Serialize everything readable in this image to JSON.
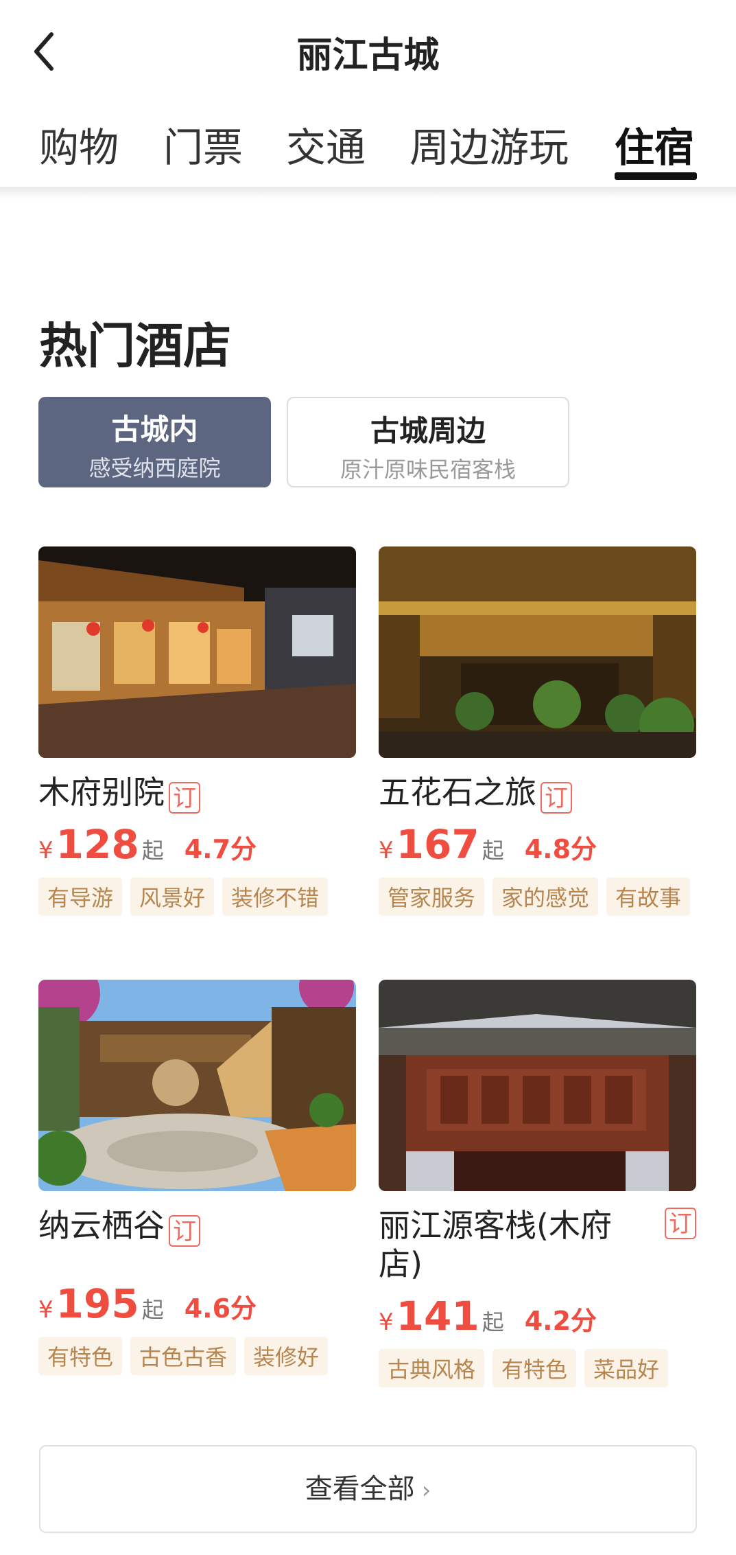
{
  "header": {
    "title": "丽江古城"
  },
  "tabs": [
    {
      "label": "购物"
    },
    {
      "label": "门票"
    },
    {
      "label": "交通"
    },
    {
      "label": "周边游玩"
    },
    {
      "label": "住宿",
      "active": true
    }
  ],
  "section": {
    "title": "热门酒店"
  },
  "filters": [
    {
      "title": "古城内",
      "subtitle": "感受纳西庭院",
      "active": true
    },
    {
      "title": "古城周边",
      "subtitle": "原汁原味民宿客栈",
      "active": false
    }
  ],
  "hotels": [
    {
      "name": "木府别院",
      "badge": "订",
      "currency": "¥",
      "price": "128",
      "suffix": "起",
      "score": "4.7分",
      "tags": [
        "有导游",
        "风景好",
        "装修不错"
      ]
    },
    {
      "name": "五花石之旅",
      "badge": "订",
      "currency": "¥",
      "price": "167",
      "suffix": "起",
      "score": "4.8分",
      "tags": [
        "管家服务",
        "家的感觉",
        "有故事"
      ]
    },
    {
      "name": "纳云栖谷",
      "badge": "订",
      "currency": "¥",
      "price": "195",
      "suffix": "起",
      "score": "4.6分",
      "tags": [
        "有特色",
        "古色古香",
        "装修好"
      ]
    },
    {
      "name": "丽江源客栈(木府店)",
      "badge": "订",
      "currency": "¥",
      "price": "141",
      "suffix": "起",
      "score": "4.2分",
      "tags": [
        "古典风格",
        "有特色",
        "菜品好"
      ]
    }
  ],
  "footer": {
    "view_all": "查看全部",
    "chevron": "›"
  },
  "colors": {
    "accent": "#f04d41",
    "filter_active": "#5d6680",
    "tag_bg": "#fbf3e8",
    "tag_text": "#b7864f"
  }
}
